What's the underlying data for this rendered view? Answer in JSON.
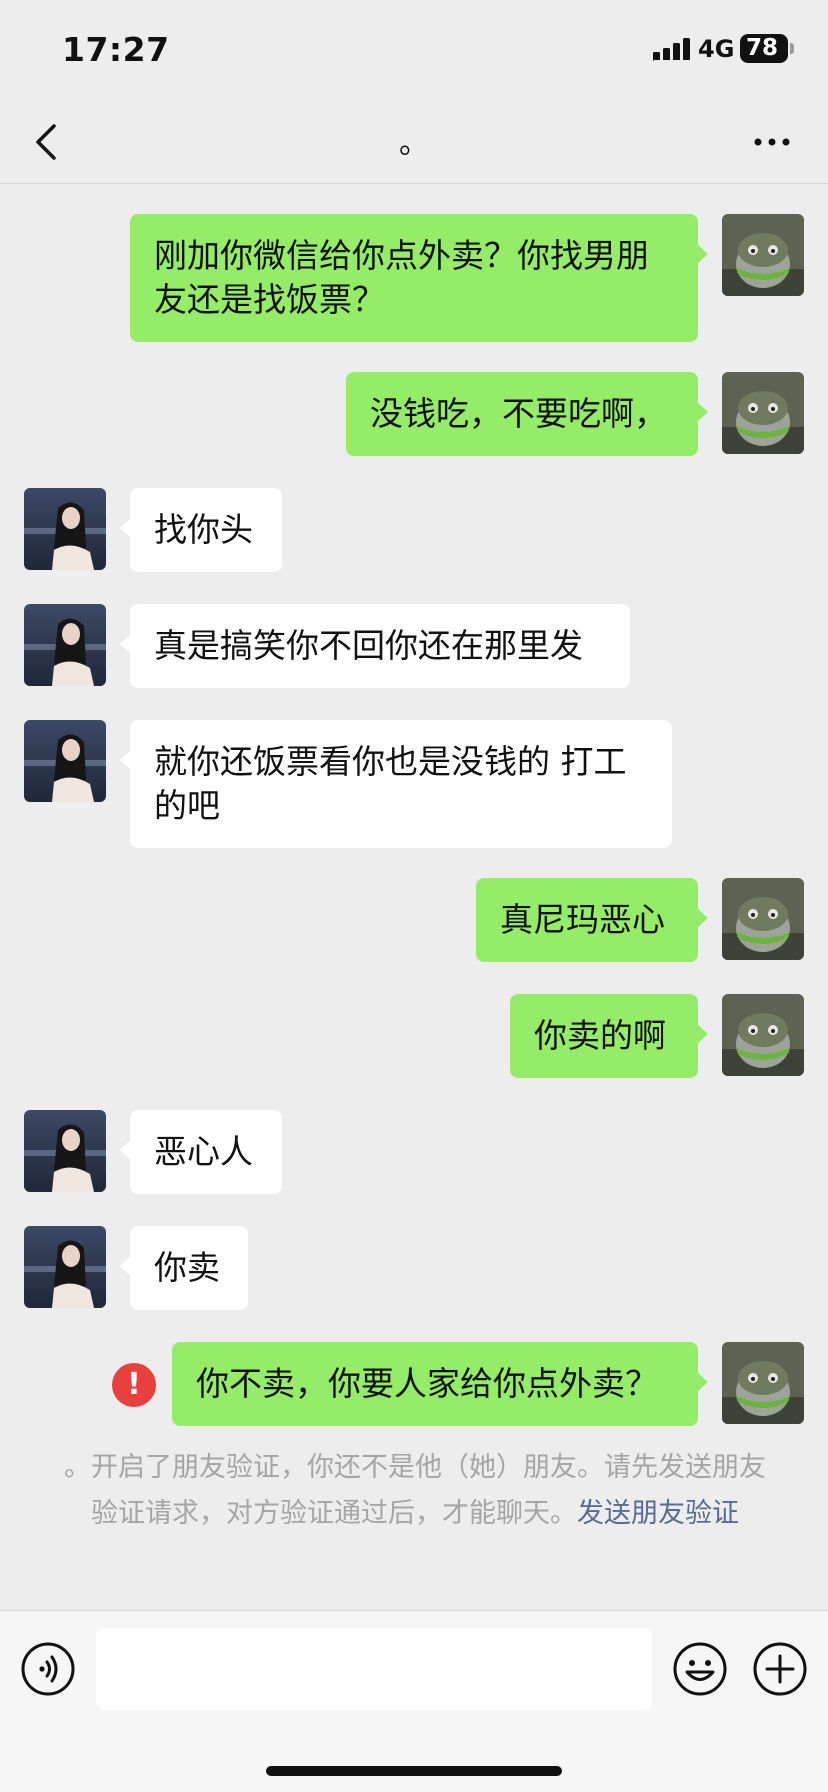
{
  "status_bar": {
    "time": "17:27",
    "network": "4G",
    "battery": "78"
  },
  "nav": {
    "title": "。",
    "back_icon": "chevron-left-icon",
    "more_icon": "ellipsis-icon"
  },
  "messages": [
    {
      "side": "mine",
      "text": "刚加你微信给你点外卖？你找男朋友还是找饭票？"
    },
    {
      "side": "mine",
      "text": "没钱吃，不要吃啊，"
    },
    {
      "side": "theirs",
      "text": "找你头"
    },
    {
      "side": "theirs",
      "text": "真是搞笑你不回你还在那里发"
    },
    {
      "side": "theirs",
      "text": "就你还饭票看你也是没钱的 打工的吧"
    },
    {
      "side": "mine",
      "text": "真尼玛恶心"
    },
    {
      "side": "mine",
      "text": "你卖的啊"
    },
    {
      "side": "theirs",
      "text": "恶心人"
    },
    {
      "side": "theirs",
      "text": "你卖"
    },
    {
      "side": "mine",
      "text": "你不卖，你要人家给你点外卖？",
      "failed": true
    }
  ],
  "error_icon_glyph": "!",
  "notice": {
    "text": "。开启了朋友验证，你还不是他（她）朋友。请先发送朋友验证请求，对方验证通过后，才能聊天。",
    "link": "发送朋友验证"
  },
  "input_bar": {
    "value": "",
    "icons": [
      "voice-icon",
      "emoji-icon",
      "plus-icon"
    ]
  },
  "colors": {
    "background": "#ededed",
    "mine_bubble": "#95ec69",
    "theirs_bubble": "#ffffff",
    "error": "#e8403e",
    "link": "#576b95"
  }
}
